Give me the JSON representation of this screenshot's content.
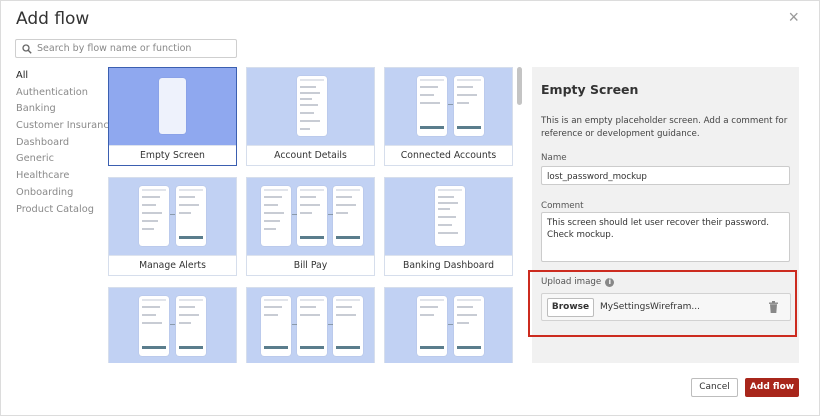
{
  "dialog": {
    "title": "Add flow",
    "close_label": "×"
  },
  "search": {
    "placeholder": "Search by flow name or function",
    "value": ""
  },
  "categories": [
    {
      "label": "All",
      "active": true
    },
    {
      "label": "Authentication",
      "active": false
    },
    {
      "label": "Banking",
      "active": false
    },
    {
      "label": "Customer Insurance",
      "active": false
    },
    {
      "label": "Dashboard",
      "active": false
    },
    {
      "label": "Generic",
      "active": false
    },
    {
      "label": "Healthcare",
      "active": false
    },
    {
      "label": "Onboarding",
      "active": false
    },
    {
      "label": "Product Catalog",
      "active": false
    }
  ],
  "flows": [
    {
      "label": "Empty Screen",
      "selected": true
    },
    {
      "label": "Account Details",
      "selected": false
    },
    {
      "label": "Connected Accounts",
      "selected": false
    },
    {
      "label": "Manage Alerts",
      "selected": false
    },
    {
      "label": "Bill Pay",
      "selected": false
    },
    {
      "label": "Banking Dashboard",
      "selected": false
    },
    {
      "label": "",
      "selected": false
    },
    {
      "label": "",
      "selected": false
    },
    {
      "label": "",
      "selected": false
    }
  ],
  "details": {
    "title": "Empty Screen",
    "description": "This is an empty placeholder screen. Add a comment for reference or development guidance.",
    "name_label": "Name",
    "name_value": "lost_password_mockup",
    "comment_label": "Comment",
    "comment_value": "This screen should let user recover their password. Check mockup.",
    "upload_label": "Upload image",
    "info_glyph": "i",
    "browse_label": "Browse",
    "file_name": "MySettingsWirefram..."
  },
  "footer": {
    "cancel_label": "Cancel",
    "add_label": "Add flow"
  },
  "colors": {
    "accent": "#a8261b",
    "highlight": "#cc2b1f",
    "selected_card": "#8fa8ef",
    "card_bg": "#c1d1f3"
  }
}
